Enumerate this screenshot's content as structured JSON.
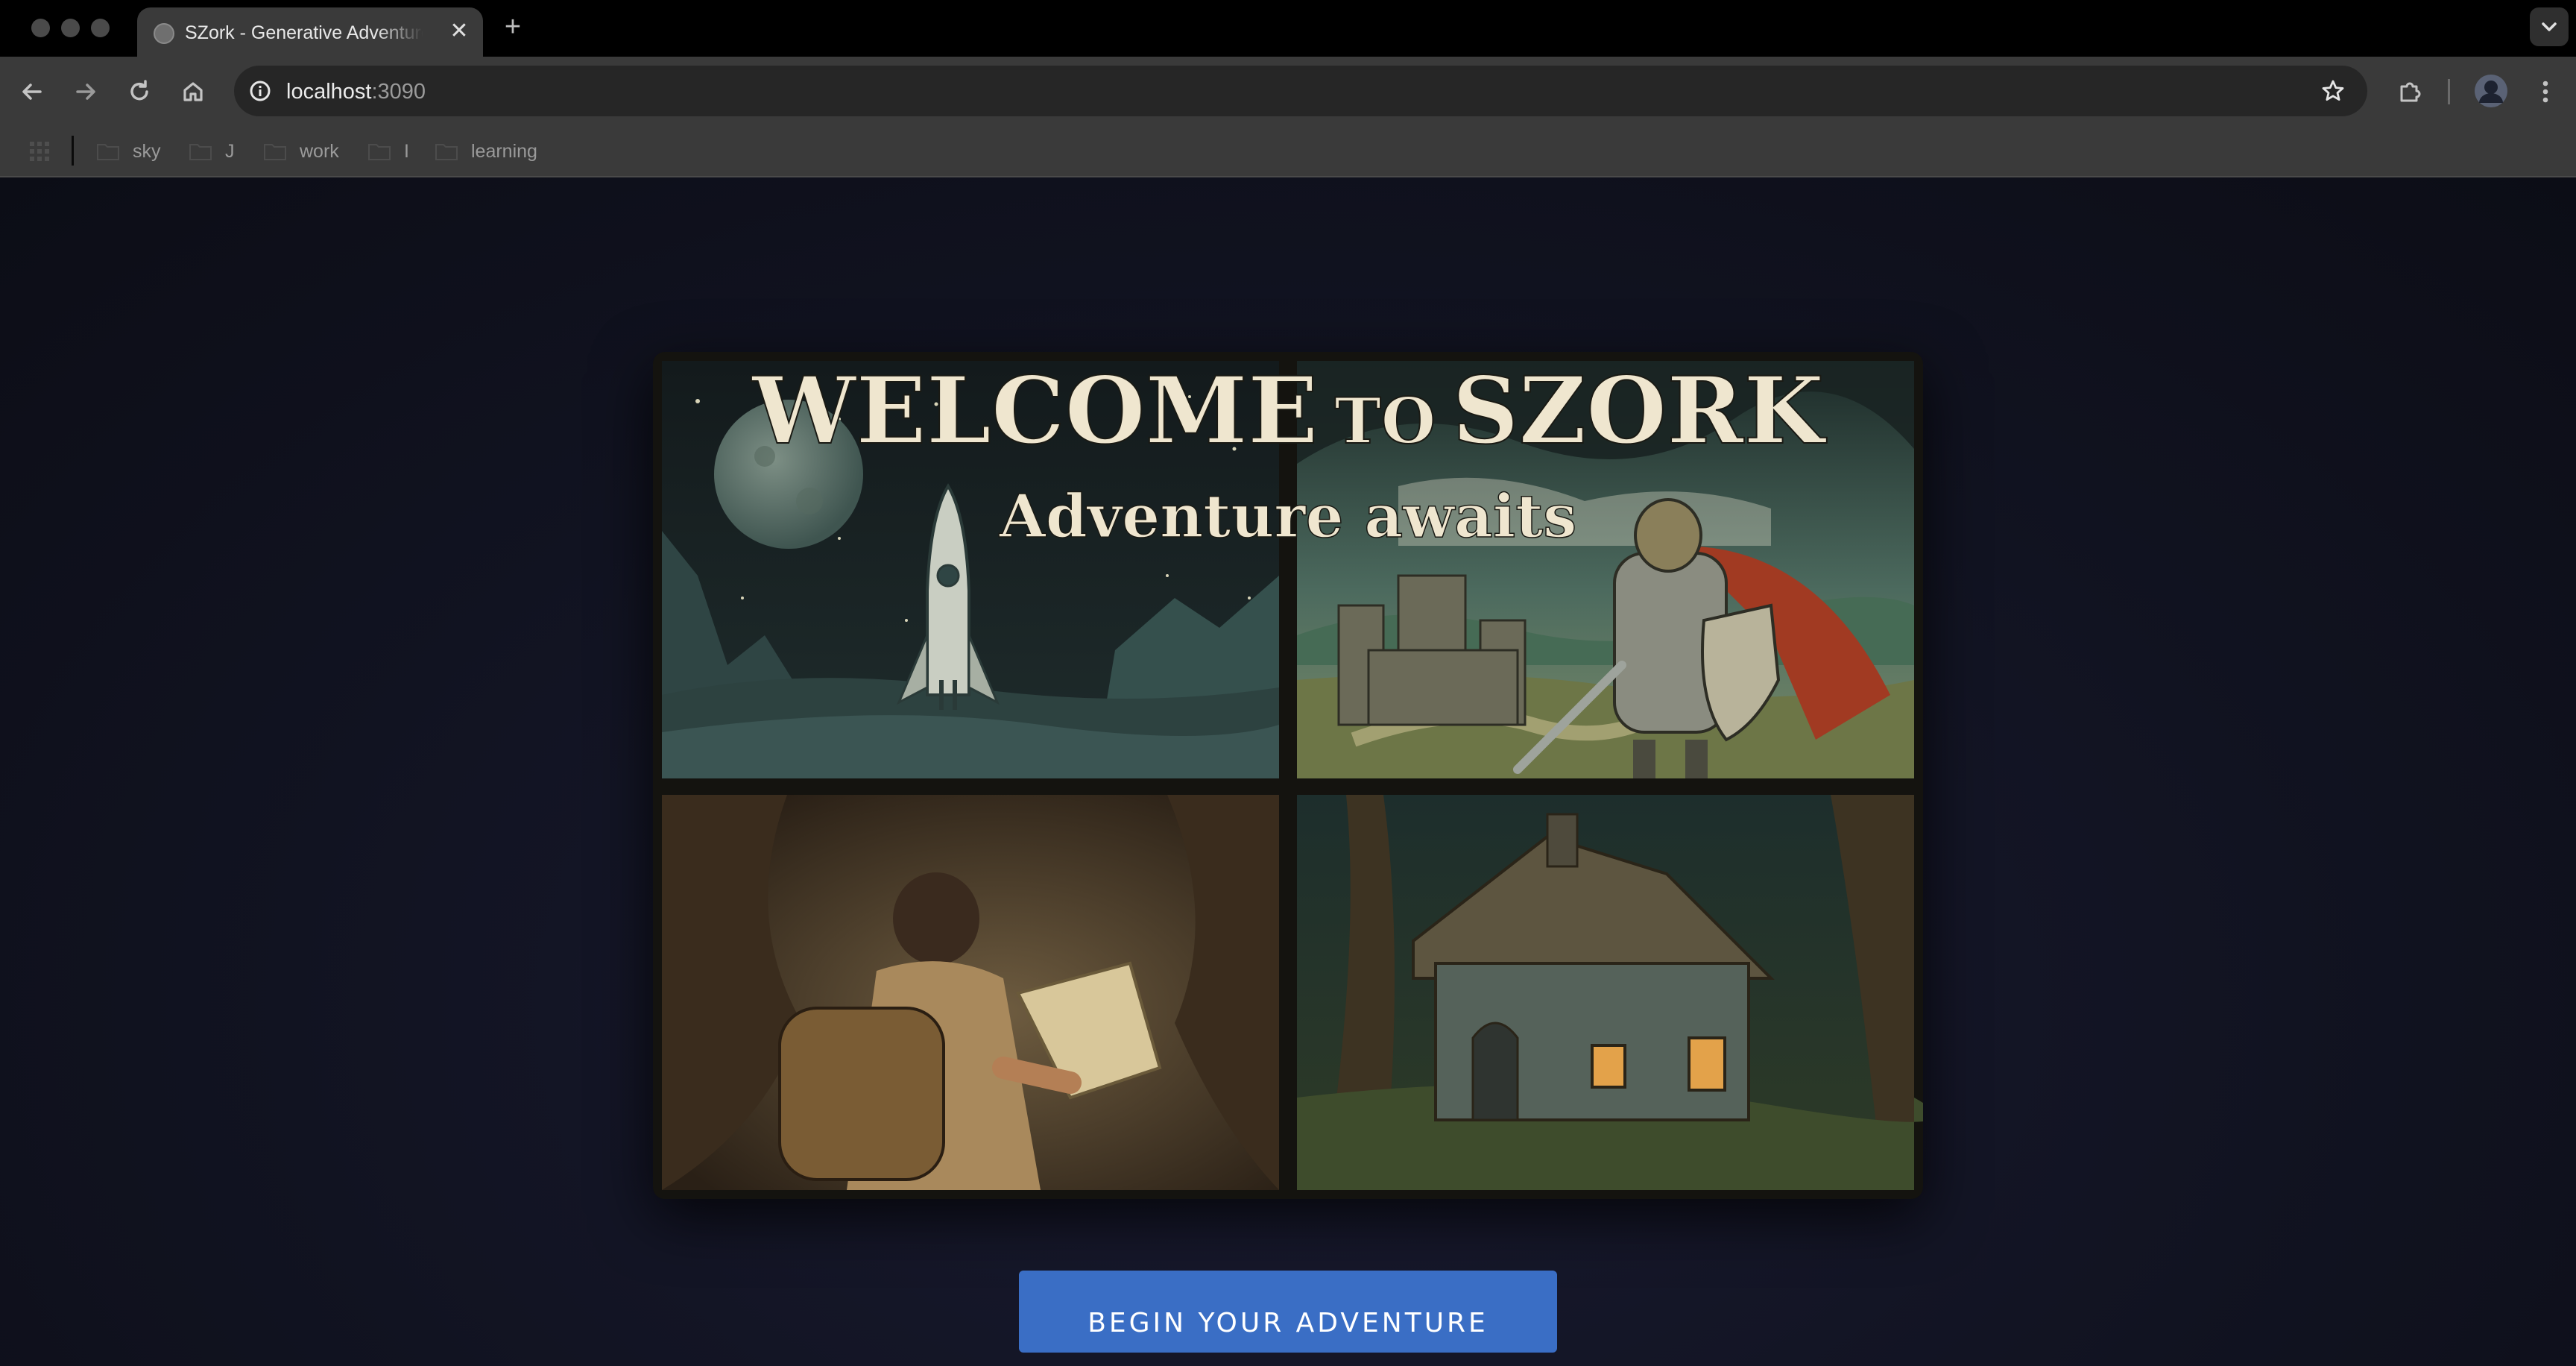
{
  "browser": {
    "tab_title": "SZork - Generative Adventure",
    "url_host": "localhost",
    "url_port": ":3090",
    "new_tab_symbol": "+",
    "close_symbol": "✕",
    "bookmarks": [
      {
        "label": ""
      },
      {
        "label": "sky"
      },
      {
        "label": "J"
      },
      {
        "label": "work"
      },
      {
        "label": "I"
      },
      {
        "label": "learning"
      }
    ]
  },
  "hero": {
    "title": "WELCOME TO SZORK",
    "title_part1": "WELCOME",
    "title_part2": "TO",
    "title_part3": "SZORK",
    "subtitle": "Adventure awaits",
    "panels": [
      "rocket-on-moon-scene",
      "knight-and-castle-scene",
      "explorer-with-map-in-cave-scene",
      "cottage-in-forest-scene"
    ]
  },
  "cta": {
    "label": "BEGIN YOUR ADVENTURE"
  },
  "colors": {
    "page_bg": "#111321",
    "cta_bg": "#3a6ec5",
    "title_text": "#efe6cf",
    "toolbar_bg": "#3a3a3a"
  }
}
